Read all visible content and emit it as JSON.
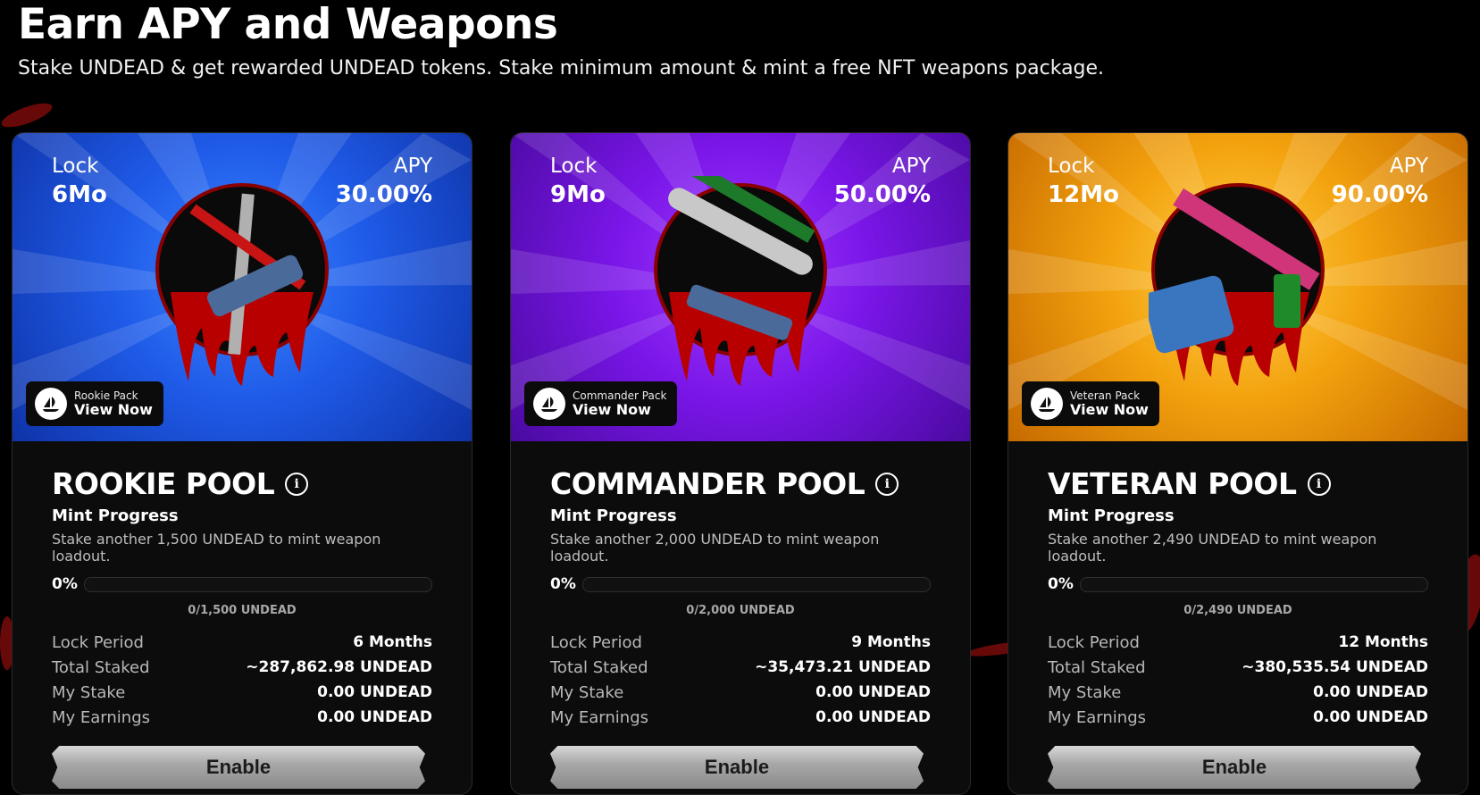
{
  "header": {
    "title": "Earn APY and Weapons",
    "subtitle": "Stake UNDEAD & get rewarded UNDEAD tokens. Stake minimum amount & mint a free NFT weapons package."
  },
  "labels": {
    "lock": "Lock",
    "apy": "APY",
    "mint_progress": "Mint Progress",
    "view_now": "View Now",
    "lock_period": "Lock Period",
    "total_staked": "Total Staked",
    "my_stake": "My Stake",
    "my_earnings": "My Earnings",
    "enable": "Enable"
  },
  "pools": [
    {
      "theme": "blue",
      "accent": "#1f5be8",
      "lock": "6Mo",
      "apy": "30.00%",
      "pack_name": "Rookie Pack",
      "title": "ROOKIE POOL",
      "mint_desc": "Stake another 1,500 UNDEAD to mint weapon loadout.",
      "progress_pct": "0%",
      "progress_fraction": 0,
      "progress_amount": "0/1,500 UNDEAD",
      "lock_period": "6 Months",
      "total_staked": "~287,862.98 UNDEAD",
      "my_stake": "0.00 UNDEAD",
      "my_earnings": "0.00 UNDEAD"
    },
    {
      "theme": "purple",
      "accent": "#7a16e8",
      "lock": "9Mo",
      "apy": "50.00%",
      "pack_name": "Commander Pack",
      "title": "COMMANDER POOL",
      "mint_desc": "Stake another 2,000 UNDEAD to mint weapon loadout.",
      "progress_pct": "0%",
      "progress_fraction": 0,
      "progress_amount": "0/2,000 UNDEAD",
      "lock_period": "9 Months",
      "total_staked": "~35,473.21 UNDEAD",
      "my_stake": "0.00 UNDEAD",
      "my_earnings": "0.00 UNDEAD"
    },
    {
      "theme": "gold",
      "accent": "#f3a20e",
      "lock": "12Mo",
      "apy": "90.00%",
      "pack_name": "Veteran Pack",
      "title": "VETERAN POOL",
      "mint_desc": "Stake another 2,490 UNDEAD to mint weapon loadout.",
      "progress_pct": "0%",
      "progress_fraction": 0,
      "progress_amount": "0/2,490 UNDEAD",
      "lock_period": "12 Months",
      "total_staked": "~380,535.54 UNDEAD",
      "my_stake": "0.00 UNDEAD",
      "my_earnings": "0.00 UNDEAD"
    }
  ]
}
